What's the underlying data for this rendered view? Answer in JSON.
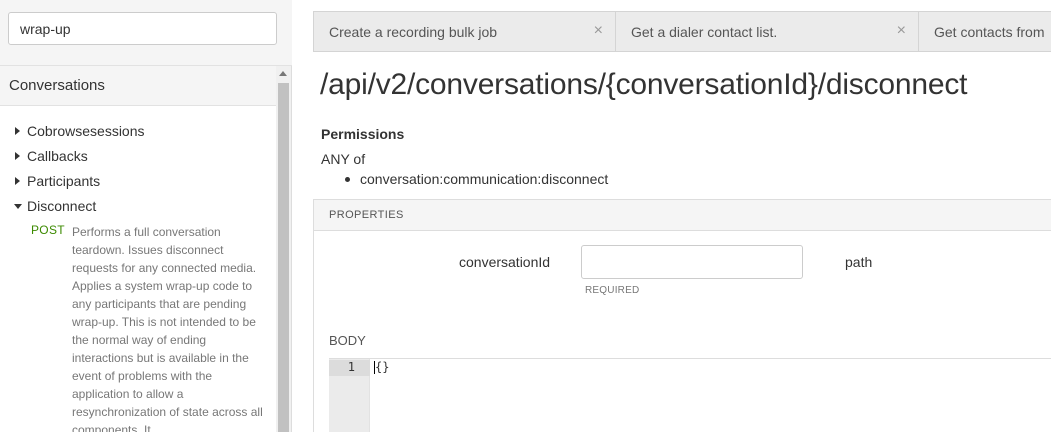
{
  "search": {
    "value": "wrap-up"
  },
  "sidebar": {
    "section_title": "Conversations",
    "items": [
      {
        "label": "Cobrowsesessions",
        "expanded": false
      },
      {
        "label": "Callbacks",
        "expanded": false
      },
      {
        "label": "Participants",
        "expanded": false
      },
      {
        "label": "Disconnect",
        "expanded": true
      }
    ],
    "endpoint": {
      "method": "POST",
      "description": "Performs a full conversation teardown. Issues disconnect requests for any connected media. Applies a system wrap-up code to any participants that are pending wrap-up. This is not intended to be the normal way of ending interactions but is available in the event of problems with the application to allow a resynchronization of state across all components. It"
    }
  },
  "tabs": [
    {
      "label": "Create a recording bulk job",
      "close": "×"
    },
    {
      "label": "Get a dialer contact list.",
      "close": "×"
    },
    {
      "label": "Get contacts from",
      "close": ""
    }
  ],
  "main": {
    "route": "/api/v2/conversations/{conversationId}/disconnect",
    "permissions_title": "Permissions",
    "permissions_any": "ANY of",
    "permissions": [
      "conversation:communication:disconnect"
    ],
    "properties_header": "PROPERTIES",
    "param": {
      "name": "conversationId",
      "value": "",
      "required": "REQUIRED",
      "location": "path"
    },
    "body_label": "BODY",
    "editor": {
      "line_number": "1",
      "code": "{}"
    }
  },
  "colors": {
    "method_post": "#3c8a00",
    "sidebar_bg": "#f5f5f5",
    "tab_bg": "#ebebeb"
  },
  "icons": [
    "caret-right-icon",
    "caret-down-icon",
    "close-icon",
    "scroll-up-icon"
  ]
}
